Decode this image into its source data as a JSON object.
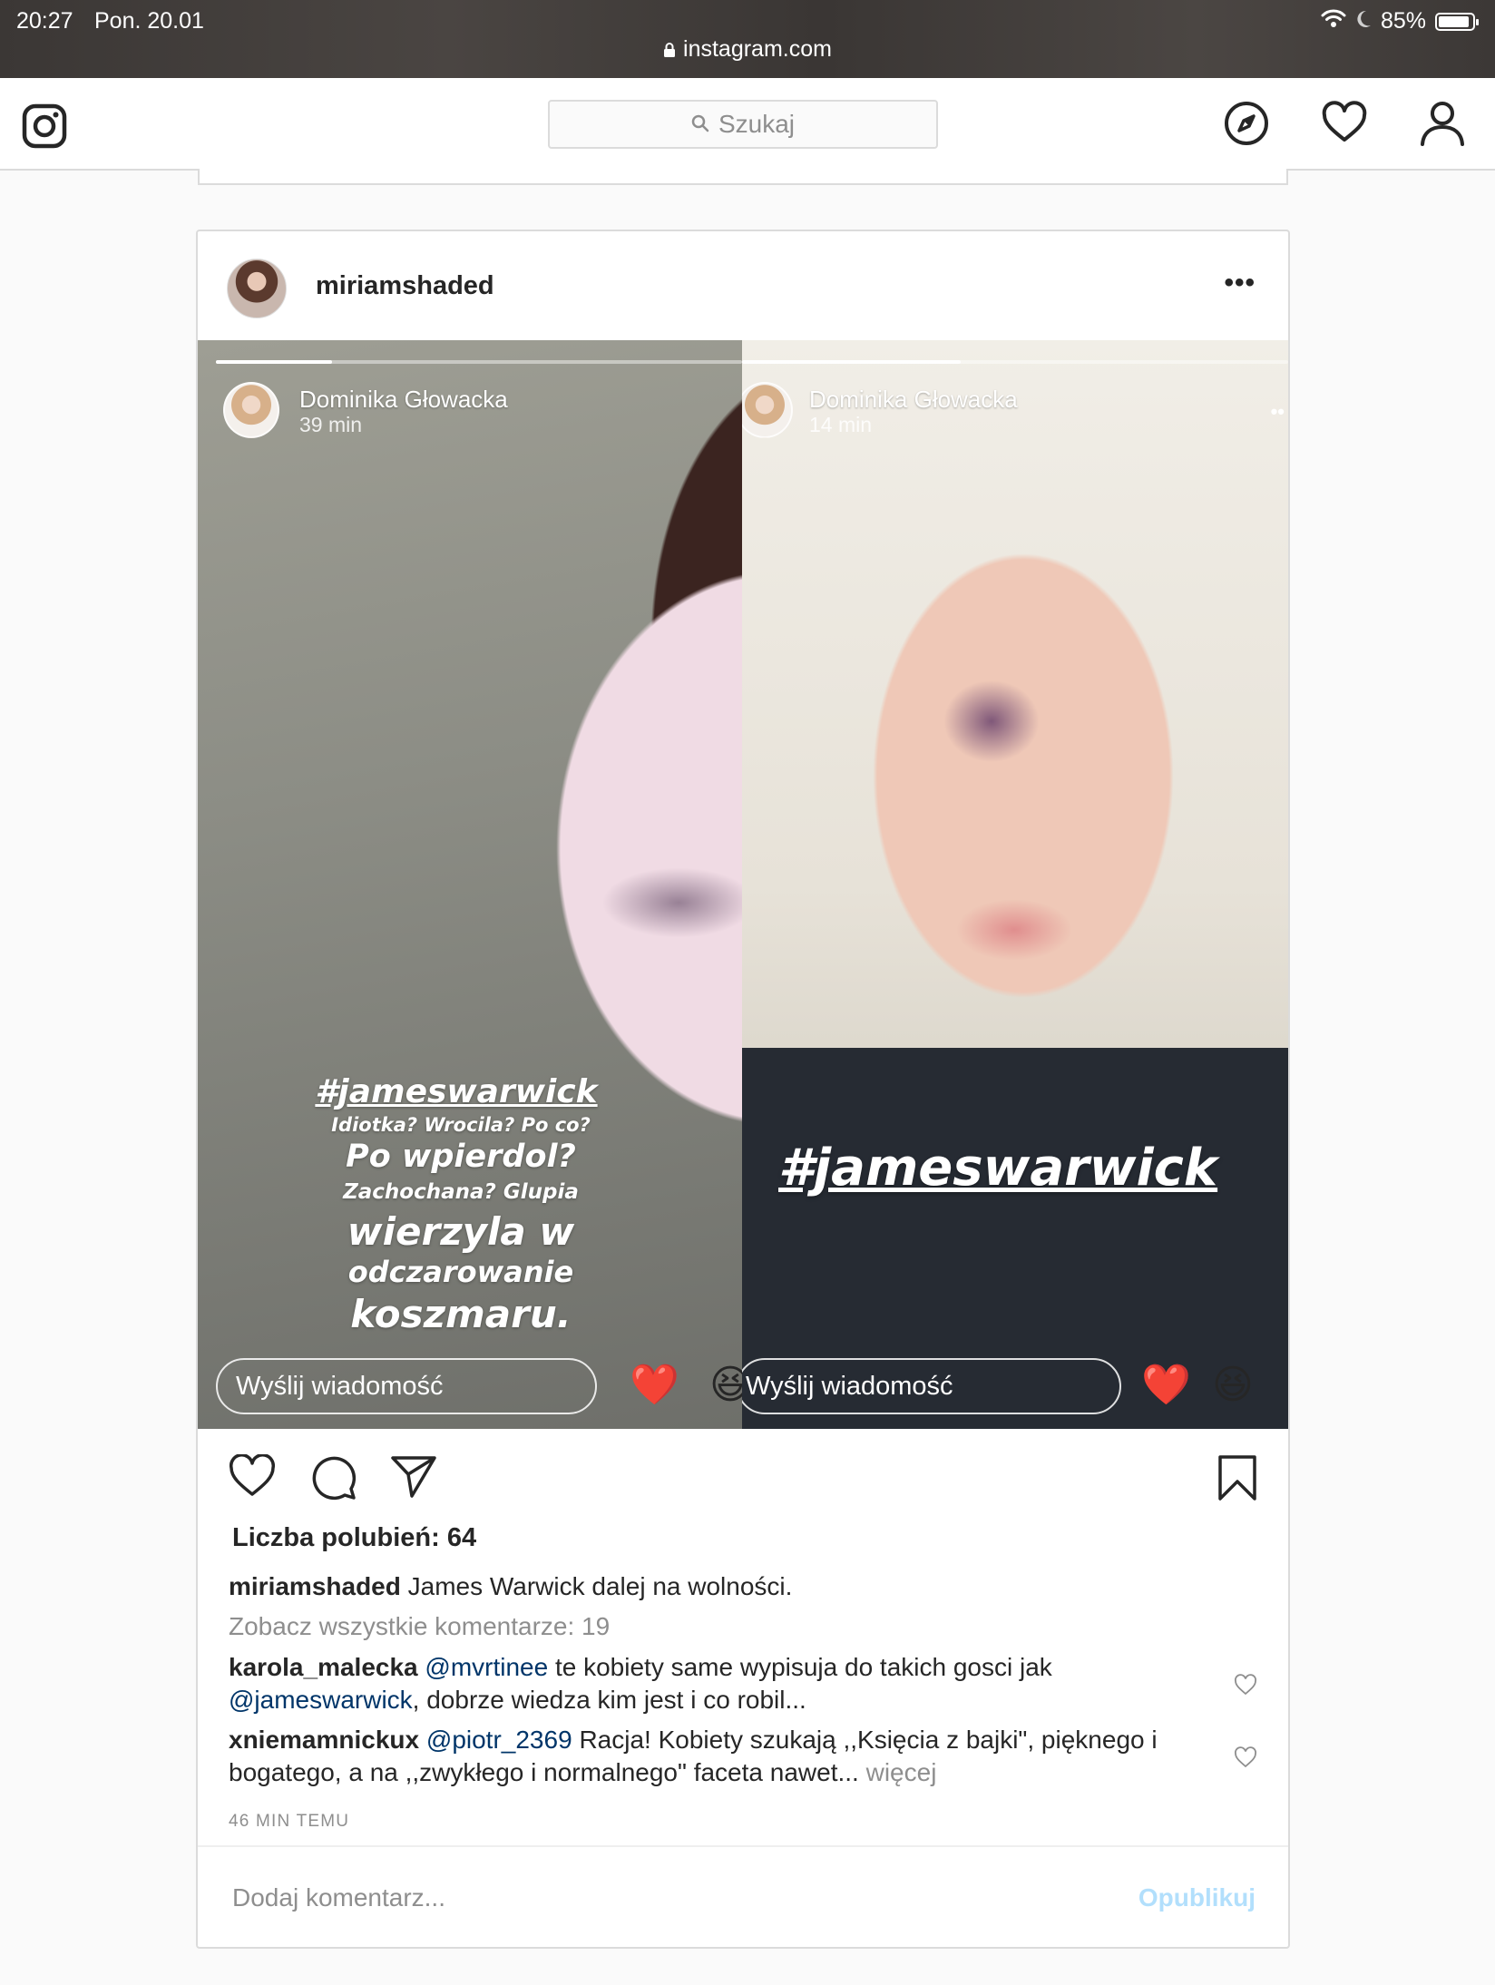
{
  "status_bar": {
    "time": "20:27",
    "date": "Pon. 20.01",
    "url": "instagram.com",
    "battery": "85%"
  },
  "nav": {
    "search_placeholder": "Szukaj",
    "icons": [
      "instagram-logo-icon",
      "search-icon",
      "compass-icon",
      "heart-icon",
      "profile-icon"
    ]
  },
  "post": {
    "username": "miriamshaded",
    "stories": [
      {
        "author": "Dominika Głowacka",
        "time": "39 min",
        "progress": 0.22,
        "caption_lines": [
          "#jameswarwick",
          "Idiotka? Wrocila? Po co?",
          "Po wpierdol?",
          "Zachochana? Glupia",
          "wierzyla w",
          "odczarowanie",
          "koszmaru."
        ],
        "reply_placeholder": "Wyślij wiadomość",
        "reactions": [
          "❤️",
          "😆"
        ]
      },
      {
        "author": "Dominika Głowacka",
        "time": "14 min",
        "progress": 0.4,
        "caption_lines": [
          "#jameswarwick"
        ],
        "reply_placeholder": "Wyślij wiadomość",
        "reactions": [
          "❤️",
          "😆"
        ]
      }
    ],
    "likes_text": "Liczba polubień: 64",
    "caption": {
      "username": "miriamshaded",
      "text": "James Warwick dalej na wolności."
    },
    "view_all_comments": "Zobacz wszystkie komentarze: 19",
    "comments": [
      {
        "username": "karola_malecka",
        "mention": "@mvrtinee",
        "text_before_mention2": "te kobiety same wypisuja do takich gosci jak",
        "mention2": "@jameswarwick",
        "text_after": ", dobrze wiedza kim jest i co robil..."
      },
      {
        "username": "xniemamnickux",
        "mention": "@piotr_2369",
        "text": "Racja! Kobiety szukają ,,Księcia z bajki\", pięknego i bogatego, a na ,,zwykłego i normalnego\" faceta nawet...",
        "more": "więcej"
      }
    ],
    "timestamp": "46 MIN TEMU",
    "add_comment_placeholder": "Dodaj komentarz...",
    "publish_label": "Opublikuj"
  }
}
